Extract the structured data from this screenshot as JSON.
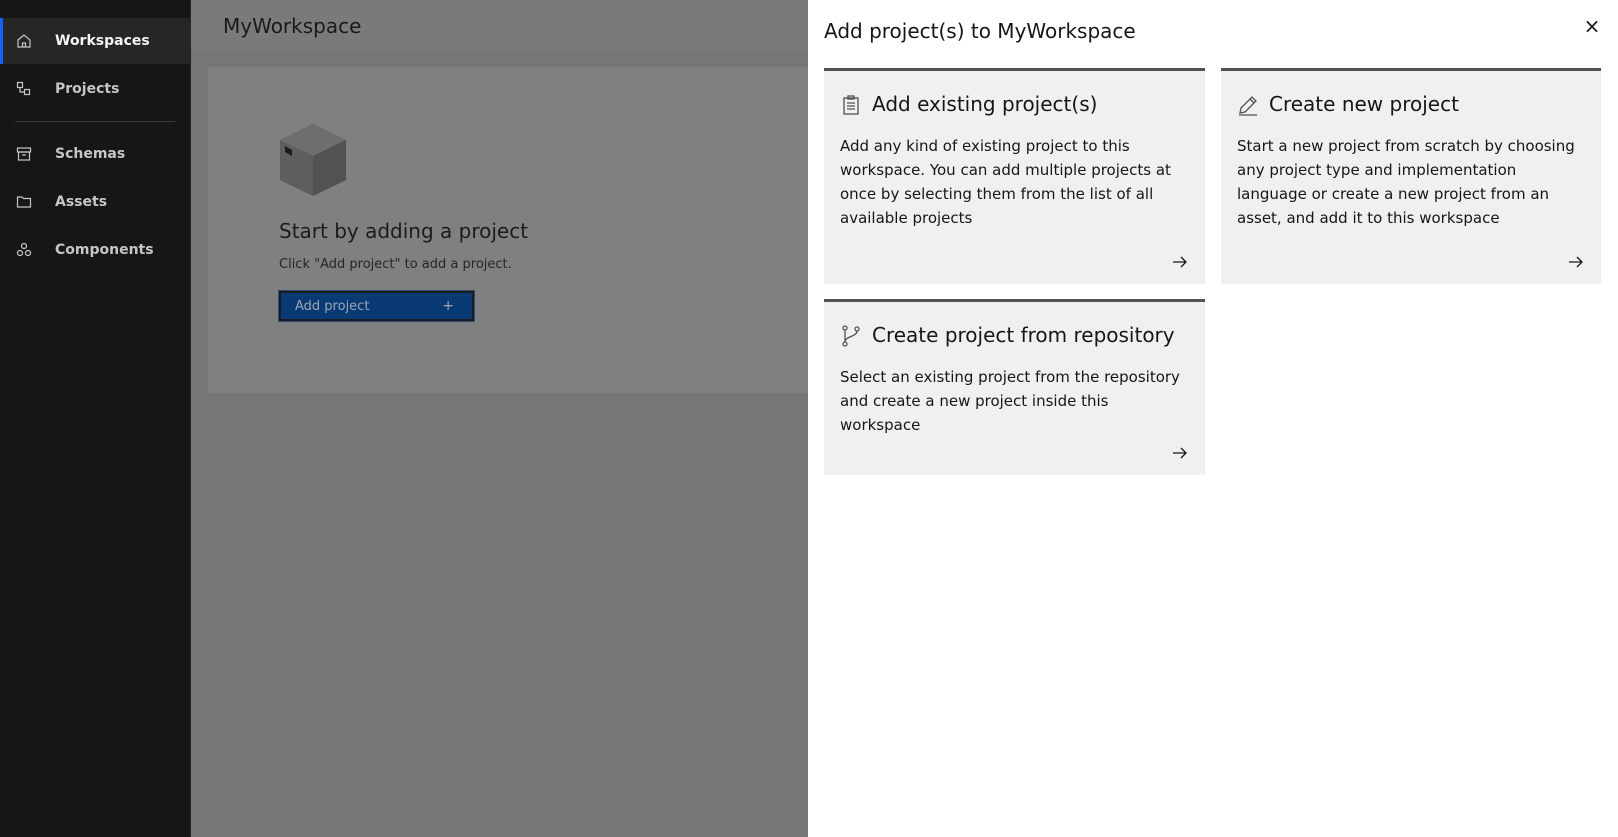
{
  "sidebar": {
    "items": [
      {
        "label": "Workspaces",
        "icon": "home-icon",
        "active": true
      },
      {
        "label": "Projects",
        "icon": "projects-icon"
      },
      {
        "label": "Schemas",
        "icon": "schemas-icon"
      },
      {
        "label": "Assets",
        "icon": "folder-icon"
      },
      {
        "label": "Components",
        "icon": "components-icon"
      }
    ]
  },
  "main": {
    "title": "MyWorkspace",
    "empty_state": {
      "heading": "Start by adding a project",
      "subtext": "Click \"Add project\" to add a project.",
      "button_label": "Add project",
      "button_icon": "+"
    }
  },
  "panel": {
    "title": "Add project(s) to MyWorkspace",
    "close_icon": "×",
    "tiles": [
      {
        "title": "Add existing project(s)",
        "icon": "clipboard-icon",
        "description": "Add any kind of existing project to this workspace. You can add multiple projects at once by selecting them from the list of all available projects"
      },
      {
        "title": "Create new project",
        "icon": "pencil-icon",
        "description": "Start a new project from scratch by choosing any project type and implementation language or create a new project from an asset, and add it to this workspace"
      },
      {
        "title": "Create project from repository",
        "icon": "branch-icon",
        "description": "Select an existing project from the repository and create a new project inside this workspace"
      }
    ]
  },
  "colors": {
    "accent": "#0f62fe",
    "sidebar_bg": "#161616",
    "overlay_bg": "#767676",
    "tile_bg": "#f0f0f0"
  }
}
